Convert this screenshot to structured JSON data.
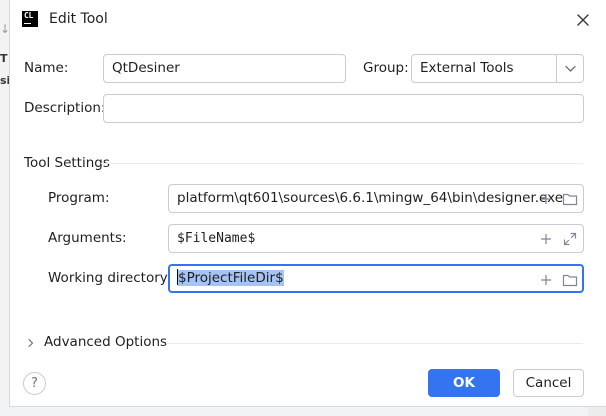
{
  "dialog": {
    "title": "Edit Tool",
    "app_icon_text": "CL"
  },
  "background_app": {
    "glyphs": [
      "↓",
      "T",
      "si"
    ]
  },
  "form": {
    "name_label": "Name:",
    "name_value": "QtDesiner",
    "group_label": "Group:",
    "group_value": "External Tools",
    "description_label": "Description:",
    "description_value": ""
  },
  "tool_settings": {
    "title": "Tool Settings",
    "program_label": "Program:",
    "program_value": "platform\\qt601\\sources\\6.6.1\\mingw_64\\bin\\designer.exe",
    "arguments_label": "Arguments:",
    "arguments_value": "$FileName$",
    "working_dir_label": "Working directory:",
    "working_dir_value": "$ProjectFileDir$"
  },
  "advanced": {
    "label": "Advanced Options"
  },
  "footer": {
    "help_label": "?",
    "ok_label": "OK",
    "cancel_label": "Cancel"
  },
  "icons": {
    "close": "close-icon",
    "dropdown": "chevron-down-icon",
    "add": "plus-icon",
    "folder": "folder-icon",
    "expand": "expand-icon",
    "chevron_right": "chevron-right-icon"
  },
  "colors": {
    "accent": "#3574f0",
    "selection": "#a6c3f5",
    "border": "#c9ccd6",
    "icon_gray": "#818594"
  }
}
